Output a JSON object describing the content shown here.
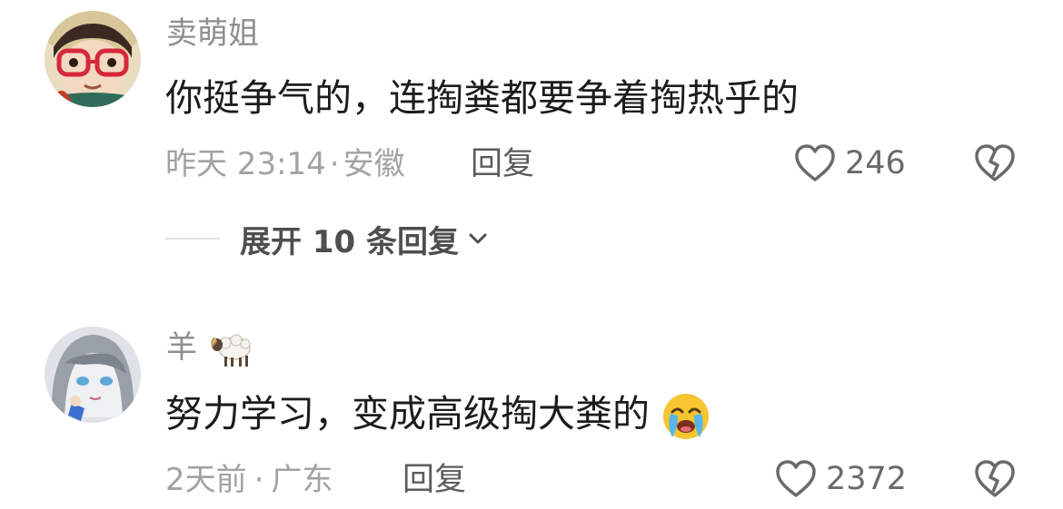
{
  "comments": [
    {
      "username": "卖萌姐",
      "text": "你挺争气的，连掏粪都要争着掏热乎的",
      "time": "昨天 23:14",
      "separator": "·",
      "location": "安徽",
      "reply_label": "回复",
      "likes": "246",
      "expand_label": "展开 10 条回复"
    },
    {
      "username": "羊",
      "username_emoji": "sheep-emoji",
      "text": "努力学习，变成高级掏大粪的",
      "text_emoji": "loudly-crying-face-emoji",
      "time": "2天前",
      "separator": "·",
      "location": "广东",
      "reply_label": "回复",
      "likes": "2372"
    }
  ],
  "colors": {
    "username": "#8e8e8e",
    "content": "#1c1c1c",
    "meta": "#a2a2a2",
    "icon": "#6a6a6a"
  }
}
